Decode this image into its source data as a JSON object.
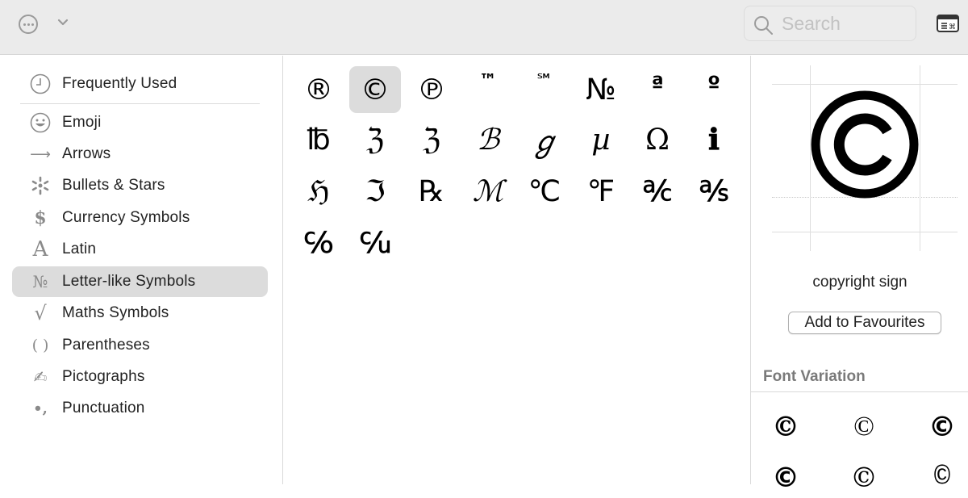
{
  "toolbar": {
    "more_icon": "ellipsis-circle-icon",
    "chevron_icon": "chevron-down-icon",
    "search": {
      "placeholder": "Search",
      "value": ""
    },
    "keyboard_viewer_icon": "keyboard-viewer-icon"
  },
  "sidebar": {
    "items": [
      {
        "label": "Frequently Used",
        "icon": "clock-icon",
        "glyph": "",
        "selected": false
      },
      {
        "label": "Emoji",
        "icon": "smiley-icon",
        "glyph": "",
        "selected": false
      },
      {
        "label": "Arrows",
        "icon": "arrow-right-icon",
        "glyph": "⟶",
        "selected": false
      },
      {
        "label": "Bullets & Stars",
        "icon": "asterisk-icon",
        "glyph": "",
        "selected": false
      },
      {
        "label": "Currency Symbols",
        "icon": "dollar-icon",
        "glyph": "$",
        "selected": false
      },
      {
        "label": "Latin",
        "icon": "latin-a-icon",
        "glyph": "A",
        "selected": false
      },
      {
        "label": "Letter-like Symbols",
        "icon": "numero-icon",
        "glyph": "№",
        "selected": true
      },
      {
        "label": "Maths Symbols",
        "icon": "square-root-icon",
        "glyph": "√",
        "selected": false
      },
      {
        "label": "Parentheses",
        "icon": "parentheses-icon",
        "glyph": "( )",
        "selected": false
      },
      {
        "label": "Pictographs",
        "icon": "writing-hand-icon",
        "glyph": "✍",
        "selected": false
      },
      {
        "label": "Punctuation",
        "icon": "punctuation-icon",
        "glyph": "•,",
        "selected": false
      }
    ]
  },
  "characters": [
    "®",
    "©",
    "℗",
    "™",
    "℠",
    "№",
    "ª",
    "º",
    "℔",
    "ℨ",
    "ℨ",
    "ℬ",
    "ℊ",
    "µ",
    "Ω",
    "ℹ",
    "ℌ",
    "ℑ",
    "℞",
    "ℳ",
    "℃",
    "℉",
    "℀",
    "℁",
    "℅",
    "℆"
  ],
  "selected_character_index": 1,
  "detail": {
    "glyph": "©",
    "name": "copyright sign",
    "add_favourites_label": "Add to Favourites",
    "font_variation_title": "Font Variation",
    "variations": [
      "©",
      "©",
      "©",
      "©",
      "©",
      "©"
    ]
  }
}
